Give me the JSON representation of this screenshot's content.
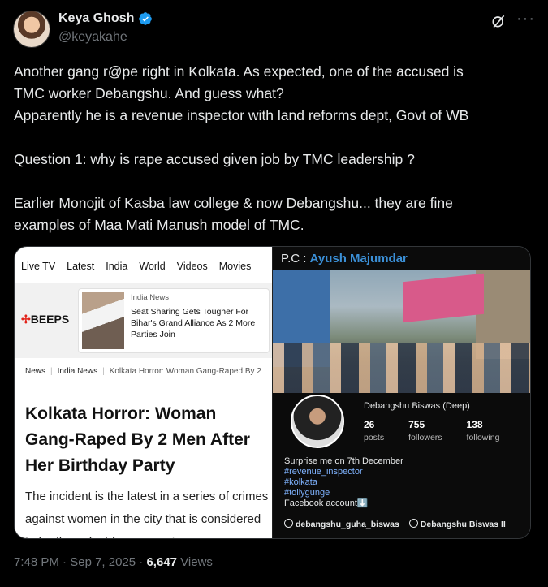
{
  "author": {
    "name": "Keya Ghosh",
    "handle": "@keyakahe"
  },
  "tweet": {
    "lines": [
      "Another gang r@pe right in Kolkata. As expected, one of the accused is",
      "TMC worker Debangshu. And guess what?",
      "Apparently he is a revenue inspector with land reforms dept, Govt of WB",
      "",
      "Question 1: why is rape accused given job by TMC leadership ?",
      "",
      "Earlier Monojit of Kasba law college & now Debangshu... they are fine",
      "examples of  Maa Mati Manush model of TMC."
    ]
  },
  "left_image": {
    "nav": [
      "Live TV",
      "Latest",
      "India",
      "World",
      "Videos",
      "Movies"
    ],
    "beeps_logo": "BEEPS",
    "beeps_mark": "✢",
    "news_card": {
      "tag": "India News",
      "headline": "Seat Sharing Gets Tougher For Bihar's Grand Alliance As 2 More Parties Join"
    },
    "breadcrumbs": [
      "News",
      "India News",
      "Kolkata Horror: Woman Gang-Raped By 2"
    ],
    "breadcrumb_sep": "|",
    "article_title": "Kolkata Horror: Woman Gang-Raped By 2 Men After Her Birthday Party",
    "article_body": "The incident is the latest in a series of crimes against women in the city that is considered to be the safest for women in"
  },
  "right_image": {
    "pc_prefix": "P.C :",
    "pc_name": "Ayush Majumdar",
    "profile": {
      "name": "Debangshu Biswas (Deep)",
      "posts": "26",
      "posts_label": "posts",
      "followers": "755",
      "followers_label": "followers",
      "following": "138",
      "following_label": "following",
      "bio": [
        "Surprise me on 7th December"
      ],
      "tags": [
        "#revenue_inspector",
        "#kolkata",
        "#tollygunge"
      ],
      "bio_tail": "Facebook account⬇️",
      "threads_handle": "debangshu_guha_biswas",
      "facebook_name": "Debangshu Biswas II"
    }
  },
  "meta": {
    "time": "7:48 PM",
    "date": "Sep 7, 2025",
    "views": "6,647",
    "views_label": "Views",
    "dot": "·"
  },
  "colors": {
    "background": "#000000",
    "text": "#e7e9ea",
    "muted": "#71767b",
    "verified": "#1d9bf0",
    "link": "#3b8fd6"
  },
  "icons": {
    "verified": "verified-badge-icon",
    "grok": "grok-icon",
    "more": "more-icon",
    "threads": "threads-icon",
    "facebook": "facebook-icon"
  }
}
